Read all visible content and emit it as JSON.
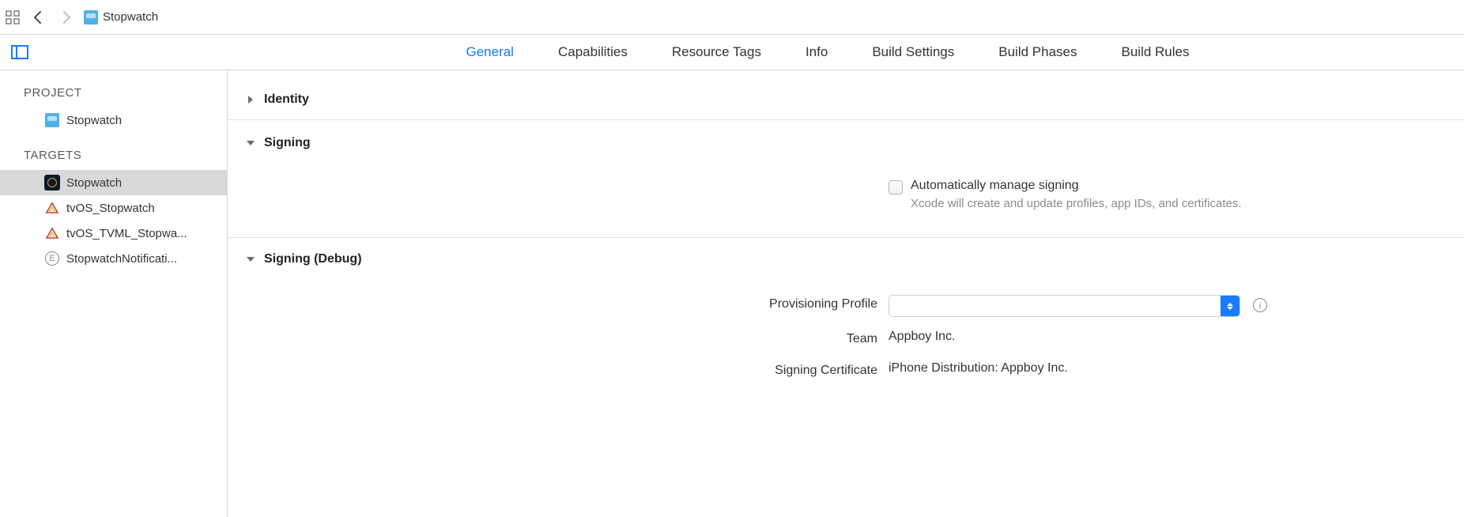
{
  "breadcrumb": {
    "title": "Stopwatch"
  },
  "tabs": [
    "General",
    "Capabilities",
    "Resource Tags",
    "Info",
    "Build Settings",
    "Build Phases",
    "Build Rules"
  ],
  "active_tab": 0,
  "sidebar": {
    "project_label": "PROJECT",
    "project_items": [
      {
        "name": "Stopwatch",
        "icon": "project"
      }
    ],
    "targets_label": "TARGETS",
    "target_items": [
      {
        "name": "Stopwatch",
        "icon": "app",
        "selected": true
      },
      {
        "name": "tvOS_Stopwatch",
        "icon": "tvos"
      },
      {
        "name": "tvOS_TVML_Stopwa...",
        "icon": "tvos"
      },
      {
        "name": "StopwatchNotificati...",
        "icon": "ext",
        "ext_badge": "E"
      }
    ]
  },
  "sections": {
    "identity": {
      "title": "Identity",
      "expanded": false
    },
    "signing": {
      "title": "Signing",
      "expanded": true,
      "auto_label": "Automatically manage signing",
      "auto_sub": "Xcode will create and update profiles, app IDs, and certificates."
    },
    "signing_debug": {
      "title": "Signing (Debug)",
      "expanded": true,
      "rows": {
        "provisioning_label": "Provisioning Profile",
        "provisioning_value": "",
        "team_label": "Team",
        "team_value": "Appboy Inc.",
        "cert_label": "Signing Certificate",
        "cert_value": "iPhone Distribution: Appboy Inc."
      }
    }
  }
}
